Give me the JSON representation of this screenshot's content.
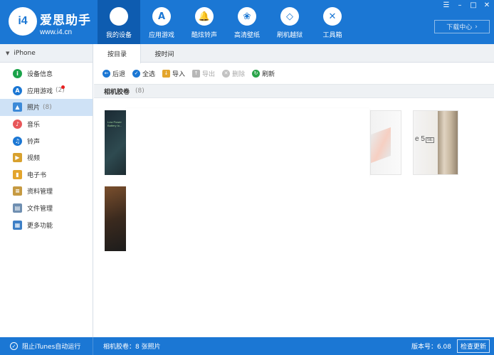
{
  "brand": {
    "mark": "i4",
    "name": "爱思助手",
    "url": "www.i4.cn"
  },
  "nav": [
    {
      "label": "我的设备",
      "icon": "apple-icon",
      "glyph": ""
    },
    {
      "label": "应用游戏",
      "icon": "app-store-icon",
      "glyph": "A"
    },
    {
      "label": "酷炫铃声",
      "icon": "bell-icon",
      "glyph": "🔔"
    },
    {
      "label": "高清壁纸",
      "icon": "flower-icon",
      "glyph": "❀"
    },
    {
      "label": "刷机越狱",
      "icon": "dropbox-icon",
      "glyph": "◇"
    },
    {
      "label": "工具箱",
      "icon": "tools-icon",
      "glyph": "✕"
    }
  ],
  "window": {
    "menu": "☰",
    "minimize": "–",
    "maximize": "□",
    "close": "✕"
  },
  "download": {
    "label": "下载中心",
    "arrow": "›"
  },
  "device": {
    "caret": "▼",
    "name": "iPhone"
  },
  "sidebar": [
    {
      "label": "设备信息",
      "icon": "info-icon",
      "color": "#1aa34a",
      "glyph": "i",
      "count": ""
    },
    {
      "label": "应用游戏",
      "icon": "app-store-icon",
      "color": "#1b77d4",
      "glyph": "A",
      "count": "(2)"
    },
    {
      "label": "照片",
      "icon": "photo-icon",
      "color": "#3d8ad8",
      "glyph": "▲",
      "count": "(8)"
    },
    {
      "label": "音乐",
      "icon": "music-icon",
      "color": "#e8575a",
      "glyph": "♪",
      "count": ""
    },
    {
      "label": "铃声",
      "icon": "bell-icon",
      "color": "#1b77d4",
      "glyph": "♫",
      "count": ""
    },
    {
      "label": "视频",
      "icon": "video-icon",
      "color": "#d8a12e",
      "glyph": "▶",
      "count": ""
    },
    {
      "label": "电子书",
      "icon": "book-icon",
      "color": "#e3a52c",
      "glyph": "▮",
      "count": ""
    },
    {
      "label": "资料管理",
      "icon": "contacts-icon",
      "color": "#c69a42",
      "glyph": "≡",
      "count": ""
    },
    {
      "label": "文件管理",
      "icon": "file-icon",
      "color": "#6f8fb1",
      "glyph": "▤",
      "count": ""
    },
    {
      "label": "更多功能",
      "icon": "grid-icon",
      "color": "#3d7fc6",
      "glyph": "▦",
      "count": ""
    }
  ],
  "tabs": [
    "按目录",
    "按时间"
  ],
  "toolbar": [
    {
      "label": "后退",
      "icon": "back-icon",
      "color": "#1b77d4",
      "glyph": "←"
    },
    {
      "label": "全选",
      "icon": "select-all-icon",
      "color": "#1b77d4",
      "glyph": "✓"
    },
    {
      "label": "导入",
      "icon": "import-icon",
      "color": "#e3a52c",
      "glyph": "↓"
    },
    {
      "label": "导出",
      "icon": "export-icon",
      "color": "#b7b7b7",
      "glyph": "↑"
    },
    {
      "label": "删除",
      "icon": "delete-icon",
      "color": "#c2c2c2",
      "glyph": "✕"
    },
    {
      "label": "刷新",
      "icon": "refresh-icon",
      "color": "#2aa44a",
      "glyph": "↻"
    }
  ],
  "section": {
    "title": "相机胶卷",
    "count": "(8)"
  },
  "photo_text": {
    "lowpower": "Low Power\nBattery lo...",
    "model": "e 5",
    "model_badge": "SE"
  },
  "status": {
    "check": "✓",
    "itunes": "阻止iTunes自动运行",
    "summary": "相机胶卷：8 张照片",
    "version": "版本号：6.08",
    "update": "检查更新"
  }
}
